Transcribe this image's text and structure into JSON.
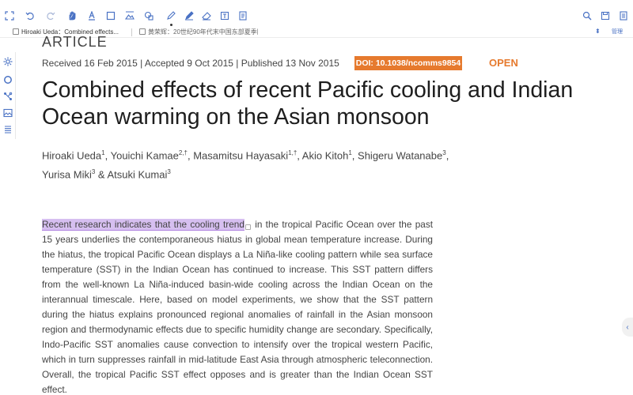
{
  "tabs": [
    {
      "label": "Hiroaki Ueda：Combined effects..."
    },
    {
      "label": "黄荣辉：20世纪90年代末中国东部夏季降..."
    }
  ],
  "tabs_right_label": "管理",
  "paper": {
    "section_label": "ARTICLE",
    "dates": "Received 16 Feb 2015 | Accepted 9 Oct 2015 | Published 13 Nov 2015",
    "doi": "DOI: 10.1038/ncomms9854",
    "open_label": "OPEN",
    "title": "Combined effects of recent Pacific cooling and Indian Ocean warming on the Asian monsoon",
    "authors": [
      {
        "name": "Hiroaki Ueda",
        "sup": "1"
      },
      {
        "name": "Youichi Kamae",
        "sup": "2,†"
      },
      {
        "name": "Masamitsu Hayasaki",
        "sup": "1,†"
      },
      {
        "name": "Akio Kitoh",
        "sup": "1"
      },
      {
        "name": "Shigeru Watanabe",
        "sup": "3"
      },
      {
        "name": "Yurisa Miki",
        "sup": "3"
      },
      {
        "name": "Atsuki Kumai",
        "sup": "3"
      }
    ],
    "abstract_highlight": "Recent research indicates that the cooling trend",
    "abstract_rest": " in the tropical Pacific Ocean over the past 15 years underlies the contemporaneous hiatus in global mean temperature increase. During the hiatus, the tropical Pacific Ocean displays a La Niña-like cooling pattern while sea surface temperature (SST) in the Indian Ocean has continued to increase. This SST pattern differs from the well-known La Niña-induced basin-wide cooling across the Indian Ocean on the interannual timescale. Here, based on model experiments, we show that the SST pattern during the hiatus explains pronounced regional anomalies of rainfall in the Asian monsoon region and thermodynamic effects due to specific humidity change are secondary. Specifically, Indo-Pacific SST anomalies cause convection to intensify over the tropical western Pacific, which in turn suppresses rainfall in mid-latitude East Asia through atmospheric teleconnection. Overall, the tropical Pacific SST effect opposes and is greater than the Indian Ocean SST effect."
  },
  "colors": {
    "accent": "#4a72c4",
    "doi_bg": "#e67a2e",
    "highlight": "#d6bff0"
  },
  "icons": {
    "toolbar": [
      "expand-icon",
      "undo-icon",
      "redo-icon",
      "hand-icon",
      "text-select-icon",
      "rect-select-icon",
      "image-icon",
      "shapes-icon",
      "pen-icon",
      "highlighter-icon",
      "eraser-icon",
      "textbox-icon",
      "note-icon",
      "search-icon",
      "save-icon",
      "more-icon"
    ],
    "left": [
      "gear-icon",
      "circle-icon",
      "mindmap-icon",
      "image-icon",
      "list-icon"
    ]
  }
}
